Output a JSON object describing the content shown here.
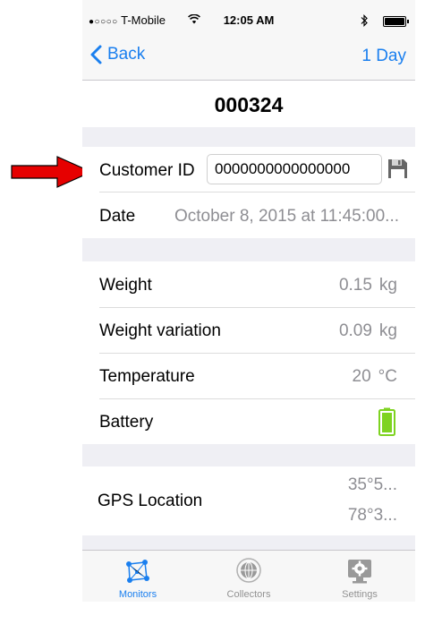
{
  "status_bar": {
    "carrier": "T-Mobile",
    "signal_dots": "●○○○○",
    "time": "12:05 AM"
  },
  "nav": {
    "back_label": "Back",
    "range_label": "1 Day"
  },
  "title": "000324",
  "customer": {
    "label": "Customer ID",
    "value": "0000000000000000"
  },
  "date": {
    "label": "Date",
    "value": "October 8, 2015 at 11:45:00..."
  },
  "readings": [
    {
      "label": "Weight",
      "value": "0.15",
      "unit": "kg"
    },
    {
      "label": "Weight variation",
      "value": "0.09",
      "unit": "kg"
    },
    {
      "label": "Temperature",
      "value": "20",
      "unit": "°C"
    }
  ],
  "battery": {
    "label": "Battery",
    "color": "#7ed321"
  },
  "gps": {
    "label": "GPS Location",
    "lat": "35°5...",
    "lon": "78°3..."
  },
  "tabs": [
    {
      "label": "Monitors",
      "icon": "monitors-icon",
      "active": true
    },
    {
      "label": "Collectors",
      "icon": "collectors-icon",
      "active": false
    },
    {
      "label": "Settings",
      "icon": "settings-icon",
      "active": false
    }
  ],
  "colors": {
    "accent": "#1a7fef",
    "annotation_arrow": "#e60000"
  }
}
